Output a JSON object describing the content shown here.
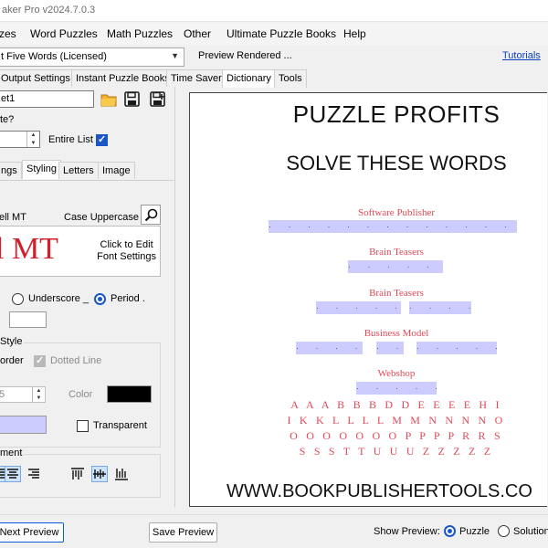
{
  "window": {
    "title": "aker Pro v2024.7.0.3"
  },
  "menu": [
    "zes",
    "Word Puzzles",
    "Math Puzzles",
    "Other",
    "Ultimate Puzzle Books",
    "Help"
  ],
  "toolbar": {
    "combo_value": "t Five Words (Licensed)",
    "preview_status": "Preview Rendered ...",
    "tutorials": "Tutorials"
  },
  "main_tabs": [
    "Output Settings",
    "Instant Puzzle Books",
    "Time Saver",
    "Dictionary",
    "Tools"
  ],
  "left": {
    "sheet_name": "et1",
    "question_label": "te?",
    "count_value": "",
    "entire_list_label": "Entire List",
    "entire_list_checked": true,
    "sub_tabs": [
      "ngs",
      "Styling",
      "Letters",
      "Image"
    ],
    "font_name": "ell MT",
    "case_label": "Case Uppercase",
    "font_sample": "l MT",
    "click_edit_line1": "Click to Edit",
    "click_edit_line2": "Font Settings",
    "underscore_label": "Underscore _",
    "period_label": "Period .",
    "style_group_label": "Style",
    "border_label": "order",
    "dotted_line_label": "Dotted Line",
    "border_width_value": "5",
    "color_label": "Color",
    "transparent_label": "Transparent",
    "alignment_group_label": "ment"
  },
  "preview": {
    "title": "PUZZLE PROFITS",
    "subtitle": "SOLVE THESE WORDS",
    "clues": [
      {
        "label": "Software Publisher"
      },
      {
        "label": "Brain Teasers"
      },
      {
        "label": "Brain Teasers"
      },
      {
        "label": "Business Model"
      },
      {
        "label": "Webshop"
      }
    ],
    "letter_rows": [
      "A A A B B B D D E E E E H I",
      "I K K L L L L M M N N N N O",
      "O O O O O O O P P P P R R S",
      "S S S T T U U U Z Z Z Z Z"
    ],
    "footer_url": "WWW.BOOKPUBLISHERTOOLS.CO"
  },
  "bottom": {
    "next_preview": "Next Preview",
    "save_preview": "Save Preview",
    "show_preview_label": "Show Preview:",
    "puzzle_label": "Puzzle",
    "solution_label": "Solution",
    "puzzle_selected": true
  },
  "colors": {
    "accent": "#1a56c8",
    "clue_red": "#e04a56",
    "answer_bar": "#ccccff",
    "font_sample_red": "#d0202c"
  }
}
